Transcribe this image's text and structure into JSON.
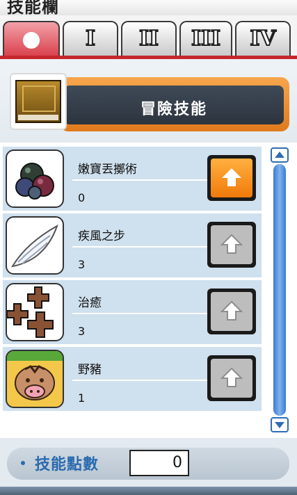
{
  "window": {
    "title": "技能欄"
  },
  "tabs": [
    {
      "label": "",
      "icon": "circle-icon",
      "active": true
    },
    {
      "label": "I",
      "active": false
    },
    {
      "label": "II",
      "active": false
    },
    {
      "label": "III",
      "active": false
    },
    {
      "label": "IV",
      "active": false
    }
  ],
  "header": {
    "title": "冒險技能",
    "icon": "skill-book-icon"
  },
  "skills": [
    {
      "name": "嫩寶丟擲術",
      "level": "0",
      "icon": "snail-shells-icon",
      "upgrade_enabled": true
    },
    {
      "name": "疾風之步",
      "level": "3",
      "icon": "wing-icon",
      "upgrade_enabled": false
    },
    {
      "name": "治癒",
      "level": "3",
      "icon": "healing-crosses-icon",
      "upgrade_enabled": false
    },
    {
      "name": "野豬",
      "level": "1",
      "icon": "boar-icon",
      "upgrade_enabled": false
    }
  ],
  "footer": {
    "label": "技能點數",
    "value": "0"
  },
  "colors": {
    "accent": "#d9434f",
    "banner": "#f08c2c",
    "blue": "#2a6ab0"
  }
}
